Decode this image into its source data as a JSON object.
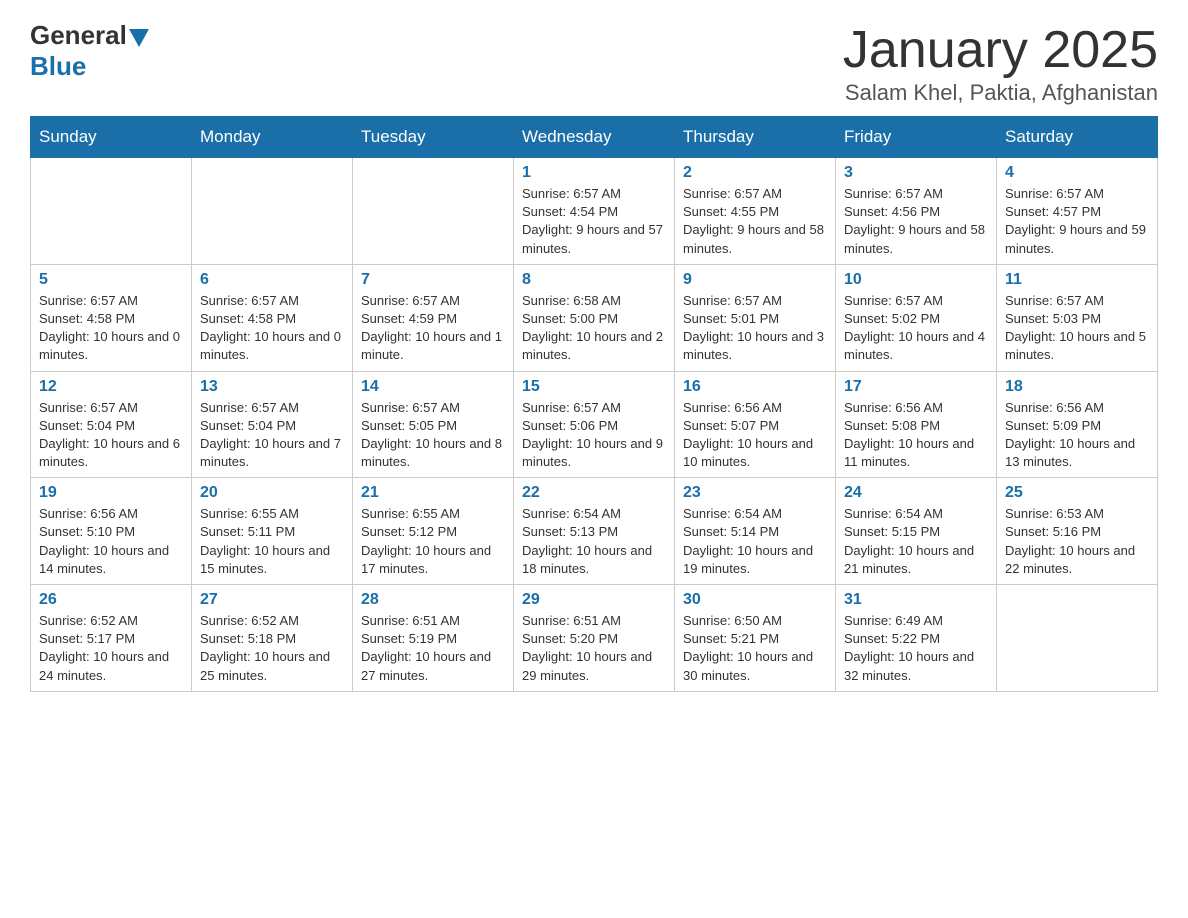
{
  "logo": {
    "general": "General",
    "blue": "Blue",
    "tagline": "Blue"
  },
  "title": {
    "month_year": "January 2025",
    "location": "Salam Khel, Paktia, Afghanistan"
  },
  "header_days": [
    "Sunday",
    "Monday",
    "Tuesday",
    "Wednesday",
    "Thursday",
    "Friday",
    "Saturday"
  ],
  "weeks": [
    [
      {
        "day": "",
        "info": ""
      },
      {
        "day": "",
        "info": ""
      },
      {
        "day": "",
        "info": ""
      },
      {
        "day": "1",
        "info": "Sunrise: 6:57 AM\nSunset: 4:54 PM\nDaylight: 9 hours and 57 minutes."
      },
      {
        "day": "2",
        "info": "Sunrise: 6:57 AM\nSunset: 4:55 PM\nDaylight: 9 hours and 58 minutes."
      },
      {
        "day": "3",
        "info": "Sunrise: 6:57 AM\nSunset: 4:56 PM\nDaylight: 9 hours and 58 minutes."
      },
      {
        "day": "4",
        "info": "Sunrise: 6:57 AM\nSunset: 4:57 PM\nDaylight: 9 hours and 59 minutes."
      }
    ],
    [
      {
        "day": "5",
        "info": "Sunrise: 6:57 AM\nSunset: 4:58 PM\nDaylight: 10 hours and 0 minutes."
      },
      {
        "day": "6",
        "info": "Sunrise: 6:57 AM\nSunset: 4:58 PM\nDaylight: 10 hours and 0 minutes."
      },
      {
        "day": "7",
        "info": "Sunrise: 6:57 AM\nSunset: 4:59 PM\nDaylight: 10 hours and 1 minute."
      },
      {
        "day": "8",
        "info": "Sunrise: 6:58 AM\nSunset: 5:00 PM\nDaylight: 10 hours and 2 minutes."
      },
      {
        "day": "9",
        "info": "Sunrise: 6:57 AM\nSunset: 5:01 PM\nDaylight: 10 hours and 3 minutes."
      },
      {
        "day": "10",
        "info": "Sunrise: 6:57 AM\nSunset: 5:02 PM\nDaylight: 10 hours and 4 minutes."
      },
      {
        "day": "11",
        "info": "Sunrise: 6:57 AM\nSunset: 5:03 PM\nDaylight: 10 hours and 5 minutes."
      }
    ],
    [
      {
        "day": "12",
        "info": "Sunrise: 6:57 AM\nSunset: 5:04 PM\nDaylight: 10 hours and 6 minutes."
      },
      {
        "day": "13",
        "info": "Sunrise: 6:57 AM\nSunset: 5:04 PM\nDaylight: 10 hours and 7 minutes."
      },
      {
        "day": "14",
        "info": "Sunrise: 6:57 AM\nSunset: 5:05 PM\nDaylight: 10 hours and 8 minutes."
      },
      {
        "day": "15",
        "info": "Sunrise: 6:57 AM\nSunset: 5:06 PM\nDaylight: 10 hours and 9 minutes."
      },
      {
        "day": "16",
        "info": "Sunrise: 6:56 AM\nSunset: 5:07 PM\nDaylight: 10 hours and 10 minutes."
      },
      {
        "day": "17",
        "info": "Sunrise: 6:56 AM\nSunset: 5:08 PM\nDaylight: 10 hours and 11 minutes."
      },
      {
        "day": "18",
        "info": "Sunrise: 6:56 AM\nSunset: 5:09 PM\nDaylight: 10 hours and 13 minutes."
      }
    ],
    [
      {
        "day": "19",
        "info": "Sunrise: 6:56 AM\nSunset: 5:10 PM\nDaylight: 10 hours and 14 minutes."
      },
      {
        "day": "20",
        "info": "Sunrise: 6:55 AM\nSunset: 5:11 PM\nDaylight: 10 hours and 15 minutes."
      },
      {
        "day": "21",
        "info": "Sunrise: 6:55 AM\nSunset: 5:12 PM\nDaylight: 10 hours and 17 minutes."
      },
      {
        "day": "22",
        "info": "Sunrise: 6:54 AM\nSunset: 5:13 PM\nDaylight: 10 hours and 18 minutes."
      },
      {
        "day": "23",
        "info": "Sunrise: 6:54 AM\nSunset: 5:14 PM\nDaylight: 10 hours and 19 minutes."
      },
      {
        "day": "24",
        "info": "Sunrise: 6:54 AM\nSunset: 5:15 PM\nDaylight: 10 hours and 21 minutes."
      },
      {
        "day": "25",
        "info": "Sunrise: 6:53 AM\nSunset: 5:16 PM\nDaylight: 10 hours and 22 minutes."
      }
    ],
    [
      {
        "day": "26",
        "info": "Sunrise: 6:52 AM\nSunset: 5:17 PM\nDaylight: 10 hours and 24 minutes."
      },
      {
        "day": "27",
        "info": "Sunrise: 6:52 AM\nSunset: 5:18 PM\nDaylight: 10 hours and 25 minutes."
      },
      {
        "day": "28",
        "info": "Sunrise: 6:51 AM\nSunset: 5:19 PM\nDaylight: 10 hours and 27 minutes."
      },
      {
        "day": "29",
        "info": "Sunrise: 6:51 AM\nSunset: 5:20 PM\nDaylight: 10 hours and 29 minutes."
      },
      {
        "day": "30",
        "info": "Sunrise: 6:50 AM\nSunset: 5:21 PM\nDaylight: 10 hours and 30 minutes."
      },
      {
        "day": "31",
        "info": "Sunrise: 6:49 AM\nSunset: 5:22 PM\nDaylight: 10 hours and 32 minutes."
      },
      {
        "day": "",
        "info": ""
      }
    ]
  ]
}
